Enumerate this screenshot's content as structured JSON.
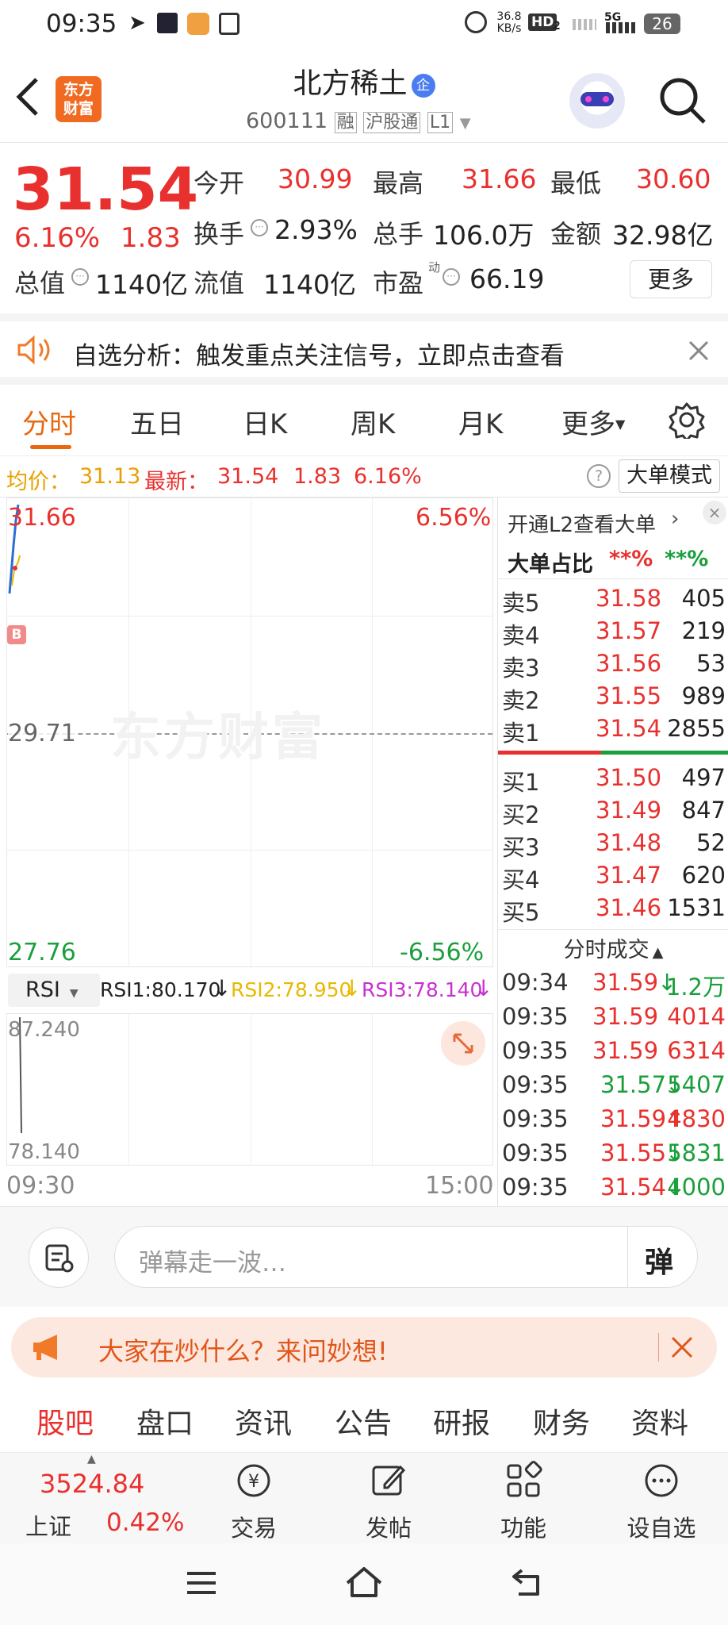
{
  "status_bar": {
    "time": "09:35",
    "net_speed": "36.8",
    "net_unit": "KB/s",
    "hd": "HD",
    "hd_sub": "2",
    "signal": "5G",
    "battery": "26"
  },
  "header": {
    "logo_line1": "东方",
    "logo_line2": "财富",
    "stock_name": "北方稀土",
    "enterprise_badge": "企",
    "code": "600111",
    "tag_margin": "融",
    "tag_connect": "沪股通",
    "tag_level": "L1"
  },
  "quote": {
    "price": "31.54",
    "change_pct": "6.16%",
    "change_amt": "1.83",
    "open_label": "今开",
    "open": "30.99",
    "high_label": "最高",
    "high": "31.66",
    "low_label": "最低",
    "low": "30.60",
    "turnover_label": "换手",
    "turnover": "2.93%",
    "volume_label": "总手",
    "volume": "106.0万",
    "amount_label": "金额",
    "amount": "32.98亿",
    "mcap_label": "总值",
    "mcap": "1140亿",
    "float_label": "流值",
    "float": "1140亿",
    "pe_label": "市盈",
    "pe_sup": "动",
    "pe": "66.19",
    "more_label": "更多"
  },
  "alert": {
    "text": "自选分析：触发重点关注信号，立即点击查看"
  },
  "chart_tabs": [
    "分时",
    "五日",
    "日K",
    "周K",
    "月K",
    "更多"
  ],
  "info_bar": {
    "avg_label": "均价：",
    "avg": "31.13",
    "latest_label": "最新：",
    "latest": "31.54",
    "change_amt": "1.83",
    "change_pct": "6.16%",
    "mode_label": "大单模式"
  },
  "chart": {
    "top_price": "31.66",
    "top_pct": "6.56%",
    "mid_price": "29.71",
    "bottom_price": "27.76",
    "bottom_pct": "-6.56%",
    "watermark": "东方财富",
    "b_marker": "B",
    "rsi_select": "RSI",
    "rsi1": "RSI1:80.170",
    "rsi2": "RSI2:78.950",
    "rsi3": "RSI3:78.140",
    "rsi_top": "87.240",
    "rsi_bottom": "78.140",
    "time_start": "09:30",
    "time_end": "15:00"
  },
  "book": {
    "l2_label": "开通L2查看大单",
    "big_order_label": "大单占比",
    "big_buy": "**%",
    "big_sell": "**%",
    "asks": [
      {
        "label": "卖5",
        "price": "31.58",
        "vol": "405"
      },
      {
        "label": "卖4",
        "price": "31.57",
        "vol": "219"
      },
      {
        "label": "卖3",
        "price": "31.56",
        "vol": "53"
      },
      {
        "label": "卖2",
        "price": "31.55",
        "vol": "989"
      },
      {
        "label": "卖1",
        "price": "31.54",
        "vol": "2855"
      }
    ],
    "bids": [
      {
        "label": "买1",
        "price": "31.50",
        "vol": "497"
      },
      {
        "label": "买2",
        "price": "31.49",
        "vol": "847"
      },
      {
        "label": "买3",
        "price": "31.48",
        "vol": "52"
      },
      {
        "label": "买4",
        "price": "31.47",
        "vol": "620"
      },
      {
        "label": "买5",
        "price": "31.46",
        "vol": "1531"
      }
    ],
    "ticks_label": "分时成交",
    "ticks": [
      {
        "time": "09:34",
        "price": "31.59",
        "arrow": "↓",
        "vol": "1.2万"
      },
      {
        "time": "09:35",
        "price": "31.59",
        "arrow": "",
        "vol": "4014"
      },
      {
        "time": "09:35",
        "price": "31.59",
        "arrow": "",
        "vol": "6314"
      },
      {
        "time": "09:35",
        "price": "31.57",
        "arrow": "↓",
        "vol": "5407"
      },
      {
        "time": "09:35",
        "price": "31.59",
        "arrow": "↑",
        "vol": "4830"
      },
      {
        "time": "09:35",
        "price": "31.55",
        "arrow": "↓",
        "vol": "5831"
      },
      {
        "time": "09:35",
        "price": "31.54",
        "arrow": "↓",
        "vol": "4000"
      }
    ]
  },
  "comment": {
    "placeholder": "弹幕走一波…",
    "danmu_label": "弹"
  },
  "banner": {
    "text": "大家在炒什么？来问妙想!"
  },
  "bottom_tabs": [
    "股吧",
    "盘口",
    "资讯",
    "公告",
    "研报",
    "财务",
    "资料"
  ],
  "footer": {
    "index_value": "3524.84",
    "index_name": "上证",
    "index_pct": "0.42%",
    "items": [
      "交易",
      "发帖",
      "功能",
      "设自选"
    ]
  }
}
